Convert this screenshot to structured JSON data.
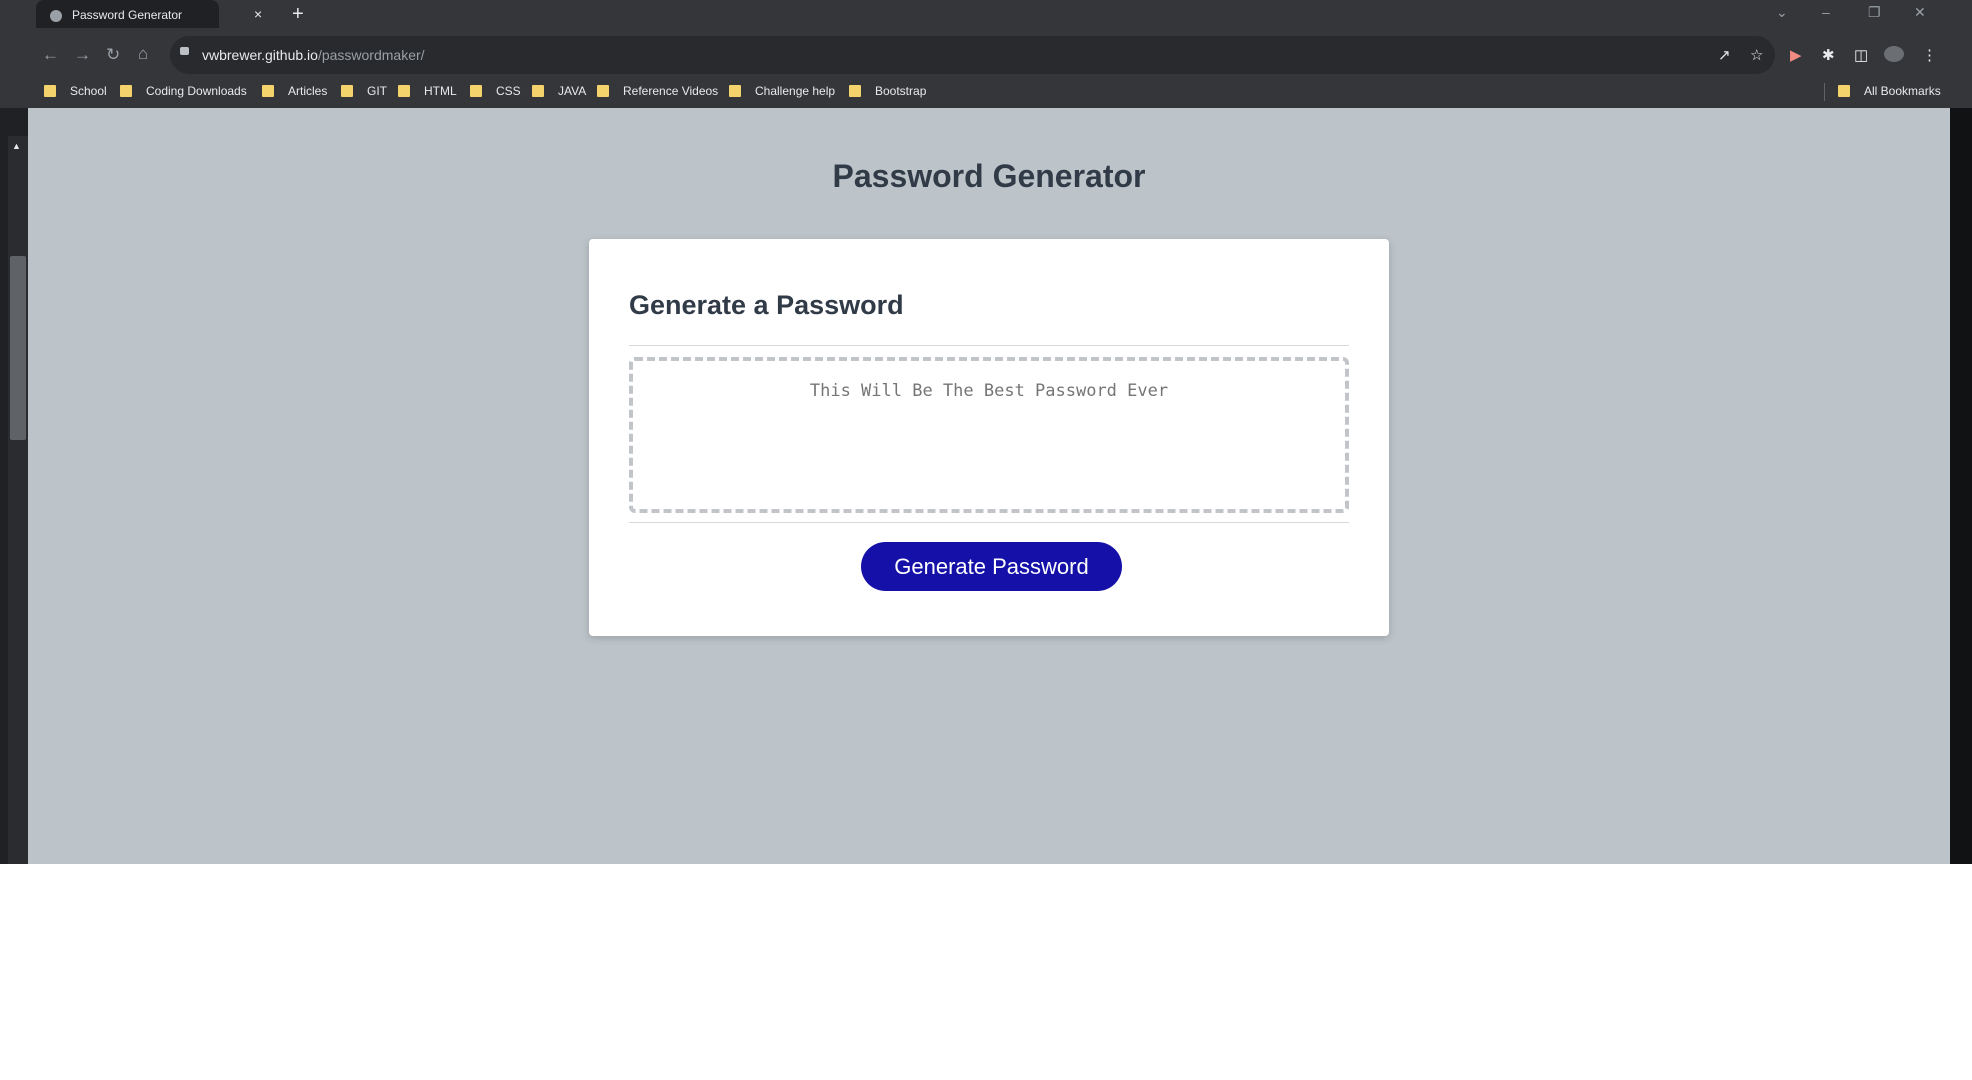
{
  "browser": {
    "tab_title": "Password Generator",
    "tab_close": "×",
    "new_tab": "+",
    "url_host": "vwbrewer.github.io",
    "url_path": "/passwordmaker/",
    "bookmarks": [
      "School",
      "Coding Downloads",
      "Articles",
      "GIT",
      "HTML",
      "CSS",
      "JAVA",
      "Reference Videos",
      "Challenge help",
      "Bootstrap"
    ],
    "all_bookmarks": "All Bookmarks"
  },
  "page": {
    "title": "Password Generator",
    "card_heading": "Generate a Password",
    "password_placeholder": "This Will Be The Best Password Ever",
    "generate_button": "Generate Password"
  },
  "colors": {
    "page_bg": "#bcc4c9",
    "button_bg": "#1511a8",
    "heading": "#313b47"
  },
  "icons": [
    "back-icon",
    "forward-icon",
    "reload-icon",
    "home-icon",
    "lock-icon",
    "share-icon",
    "star-icon",
    "extension-icon",
    "sidebar-icon",
    "profile-icon",
    "menu-icon",
    "folder-icon"
  ]
}
